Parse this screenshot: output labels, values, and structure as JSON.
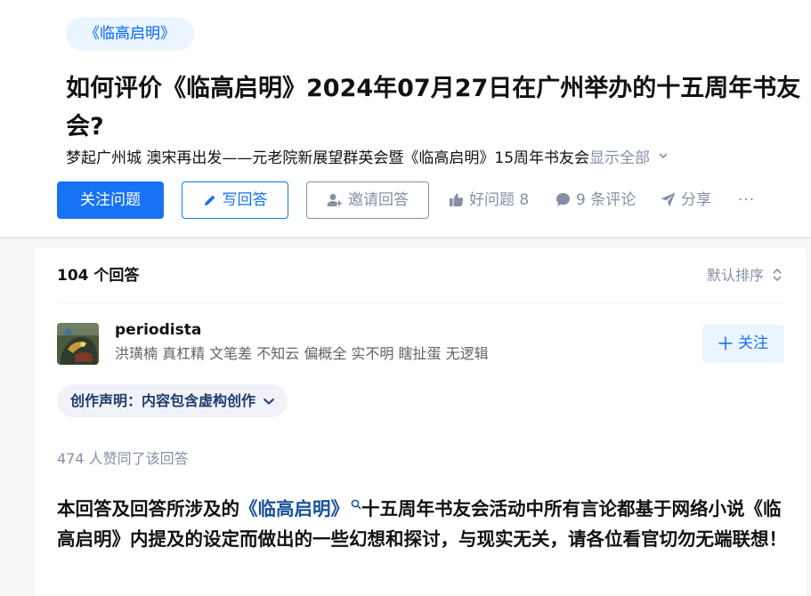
{
  "question": {
    "topic_tag": "《临高启明》",
    "title": "如何评价《临高启明》2024年07月27日在广州举办的十五周年书友会?",
    "detail": "梦起广州城 澳宋再出发——元老院新展望群英会暨《临高启明》15周年书友会",
    "show_all": "显示全部",
    "actions": {
      "follow": "关注问题",
      "write": "写回答",
      "invite": "邀请回答",
      "like": "好问题 8",
      "comments": "9 条评论",
      "share": "分享",
      "more": "···"
    }
  },
  "answers": {
    "count_label": "104 个回答",
    "sort_label": "默认排序",
    "items": [
      {
        "author_name": "periodista",
        "author_bio": "洪璜楠 真杠精 文笔差 不知云 偏概全 实不明 瞎扯蛋 无逻辑",
        "follow_label": "关注",
        "creation_statement": "创作声明：内容包含虚构创作",
        "voters": "474 人赞同了该回答",
        "body": {
          "prefix": "本回答及回答所涉及的",
          "topic_link": "《临高启明》",
          "suffix": "十五周年书友会活动中所有言论都基于网络小说《临高启明》内提及的设定而做出的一些幻想和探讨，与现实无关，请各位看官切勿无端联想！"
        }
      }
    ]
  },
  "colors": {
    "primary": "#1772f6",
    "muted": "#8590a6",
    "tag_bg": "#ebf5ff",
    "page_bg": "#f6f6f6",
    "link": "#175199"
  },
  "icons": [
    "pencil-icon",
    "invite-user-icon",
    "thumb-up-icon",
    "comment-bubble-icon",
    "paper-plane-icon",
    "sort-arrows-icon",
    "plus-icon",
    "chevron-down-icon",
    "search-icon"
  ]
}
